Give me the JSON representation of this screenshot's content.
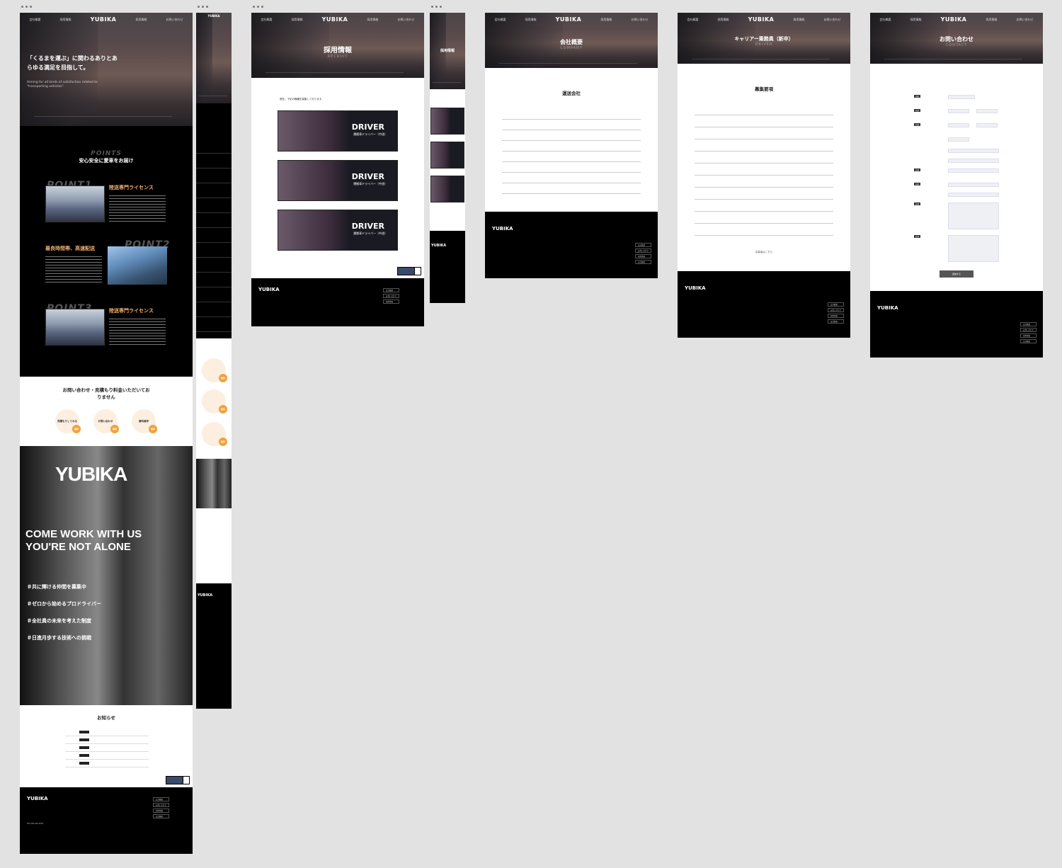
{
  "brand": "YUBIKA",
  "nav": [
    "会社概要",
    "採用情報",
    "採用情報",
    "お問い合わせ"
  ],
  "home": {
    "hero_title": "「くるまを運ぶ」に関わるありとあらゆる満足を目指して。",
    "hero_sub": "Aiming for all kinds of satisfaction related to \"transporting vehicles\"",
    "points_label": "POINTS",
    "points_title": "安心安全に愛車をお届け",
    "point1_num": "POINT1",
    "point1_title": "陸送専門ライセンス",
    "point2_num": "POINT2",
    "point2_title": "最良時間帯、高速配送",
    "point3_num": "POINT3",
    "point3_title": "陸送専門ライセンス",
    "contact_title": "お問い合わせ・見積もり料金いただいておりません",
    "circles": [
      "見積もりしてみる",
      "お問い合わせ",
      "資料請求"
    ],
    "circle_badge": "無料",
    "recruit_en": "COME WORK WITH US YOU'RE NOT ALONE",
    "tags": [
      "＃共に輝ける仲間を募集中",
      "＃ゼロから始めるプロドライバー",
      "＃全社員の未来を考えた制度",
      "＃日進月歩する技術への挑戦"
    ],
    "news_title": "お知らせ"
  },
  "recruit": {
    "title": "採用情報",
    "sub": "RECRUIT",
    "intro": "現在、下記の職種を募集しております。",
    "card_title": "DRIVER",
    "card_sub": "運搬車ドライバー（中途）"
  },
  "company": {
    "title": "会社概要",
    "sub": "COMPANY",
    "heading": "運送会社"
  },
  "career": {
    "title": "キャリアー乗務員（新卒）",
    "sub": "DRIVER",
    "heading": "募集要項",
    "link": "応募者はこちら"
  },
  "contact": {
    "title": "お問い合わせ",
    "sub": "CONTACT",
    "submit": "送信する",
    "required": "必須"
  },
  "footer": {
    "links": [
      "会社概要",
      "お問い合わせ",
      "採用情報",
      "会社概要",
      "資料請求"
    ],
    "tel": "TEL:000-000-0000"
  }
}
